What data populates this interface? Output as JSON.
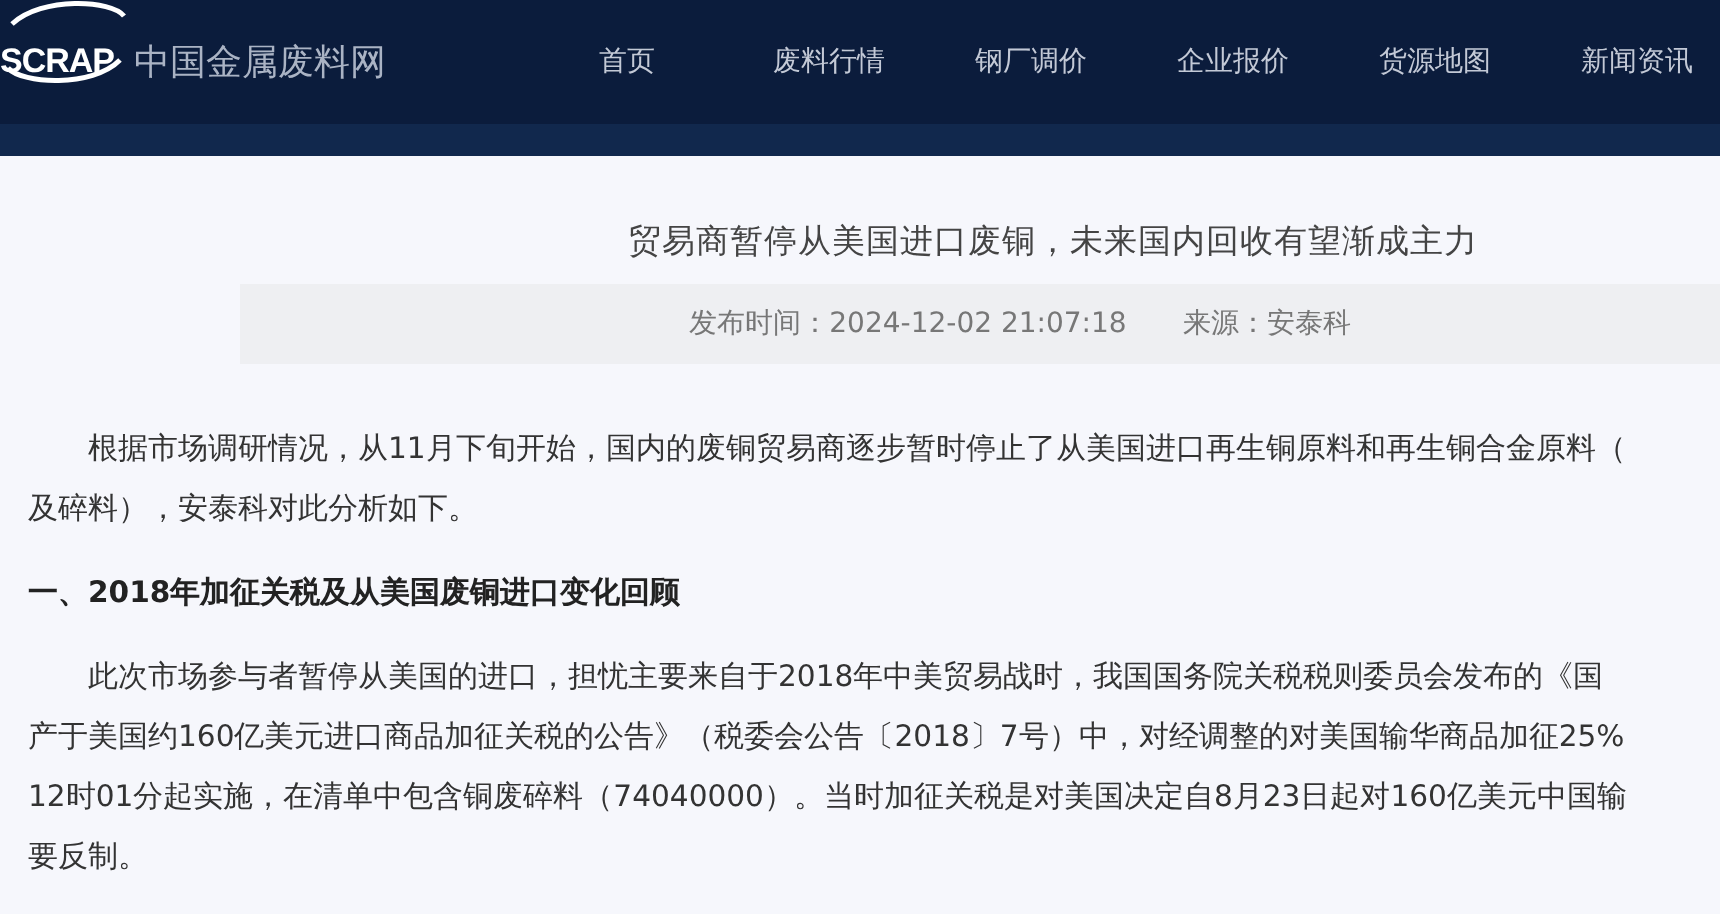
{
  "header": {
    "logo": "SCRAP",
    "site_name": "中国金属废料网",
    "nav": [
      {
        "label": "首页"
      },
      {
        "label": "废料行情"
      },
      {
        "label": "钢厂调价"
      },
      {
        "label": "企业报价"
      },
      {
        "label": "货源地图"
      },
      {
        "label": "新闻资讯"
      }
    ]
  },
  "article": {
    "title": "贸易商暂停从美国进口废铜，未来国内回收有望渐成主力",
    "meta": [
      {
        "text": "发布时间：2024-12-02 21:07:18"
      },
      {
        "text": "来源：安泰科"
      }
    ],
    "body": [
      {
        "kind": "paragraph",
        "lines": [
          "根据市场调研情况，从11月下旬开始，国内的废铜贸易商逐步暂时停止了从美国进口再生铜原料和再生铜合金原料（",
          "及碎料），安泰科对此分析如下。"
        ]
      },
      {
        "kind": "heading",
        "lines": [
          "一、2018年加征关税及从美国废铜进口变化回顾"
        ]
      },
      {
        "kind": "paragraph",
        "lines": [
          "此次市场参与者暂停从美国的进口，担忧主要来自于2018年中美贸易战时，我国国务院关税税则委员会发布的《国",
          "产于美国约160亿美元进口商品加征关税的公告》（税委会公告〔2018〕7号）中，对经调整的对美国输华商品加征25%",
          "12时01分起实施，在清单中包含铜废碎料（74040000）。当时加征关税是对美国决定自8月23日起对160亿美元中国输",
          "要反制。"
        ]
      }
    ]
  }
}
